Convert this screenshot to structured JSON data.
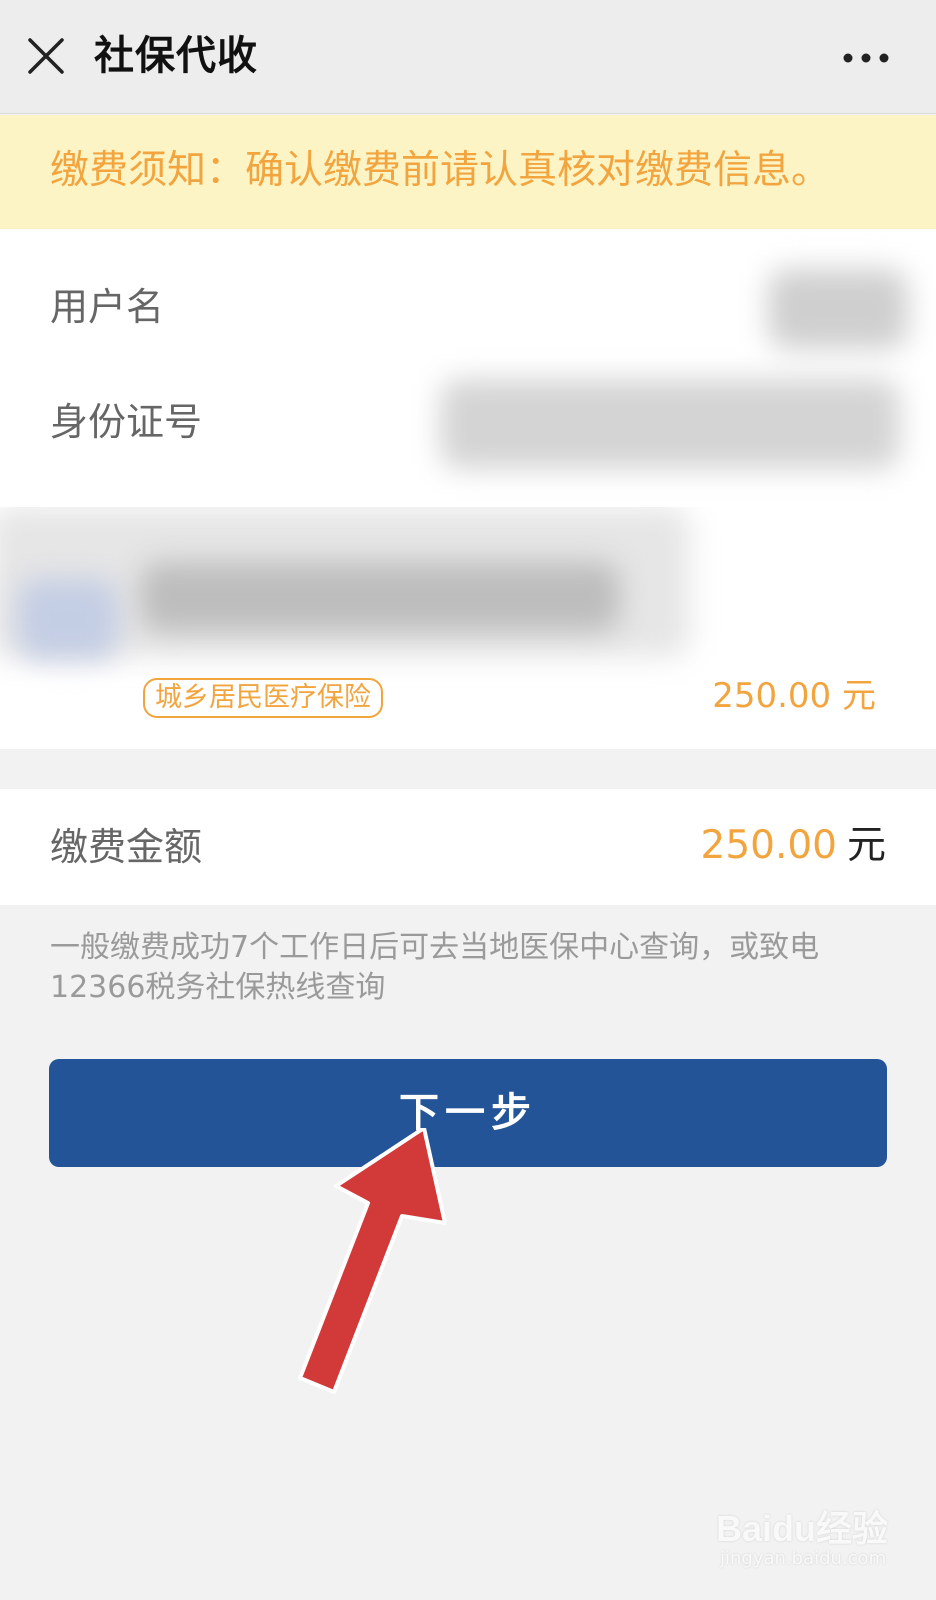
{
  "titlebar": {
    "title": "社保代收",
    "close_icon": "close-icon",
    "more_icon": "more-icon"
  },
  "notice": {
    "text": "缴费须知：确认缴费前请认真核对缴费信息。"
  },
  "info": {
    "username_label": "用户名",
    "id_label": "身份证号"
  },
  "item": {
    "tag": "城乡居民医疗保险",
    "amount": "250.00 元"
  },
  "payment": {
    "label": "缴费金额",
    "value": "250.00",
    "unit": "元"
  },
  "hint": "一般缴费成功7个工作日后可去当地医保中心查询，或致电12366税务社保热线查询",
  "next_button": "下一步",
  "watermark": {
    "main": "Baidu经验",
    "sub": "jingyan.baidu.com"
  },
  "colors": {
    "accent_orange": "#f2a53f",
    "notice_bg": "#fdf4c5",
    "button_blue": "#235497",
    "arrow_red": "#d23a3a"
  }
}
